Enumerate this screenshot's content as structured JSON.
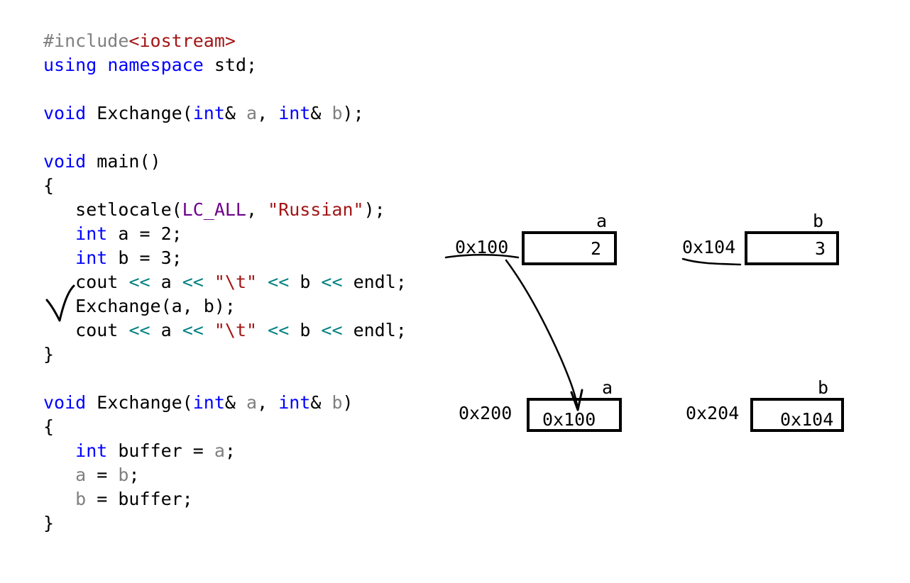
{
  "code": {
    "include_directive": "#include",
    "include_file": "<iostream>",
    "using_kw": "using",
    "namespace_kw": "namespace",
    "std_rest": " std;",
    "void_kw": "void",
    "int_kw": "int",
    "int_ref": "int&",
    "exchange_name": " Exchange(",
    "decl_end": ");",
    "def_end": ")",
    "main_sig": " main()",
    "open_brace": "{",
    "close_brace": "}",
    "param_a": "a",
    "param_b": "b",
    "comma": ", ",
    "sp": " ",
    "setlocale": "setlocale(",
    "lc_all": "LC_ALL",
    "russian": "\"Russian\"",
    "int_a_rest": " a = 2;",
    "int_b_rest": " b = 3;",
    "cout": "cout",
    "shift": "<<",
    "a_mid": " a ",
    "b_mid": " b ",
    "tab_str": "\"\\t\"",
    "endl_rest": " endl;",
    "exchange_call": "Exchange(a, b);",
    "buffer_rest": " buffer = ",
    "semicolon": ";",
    "assign": " = ",
    "buffer_end": "buffer;"
  },
  "diagram": {
    "row1": {
      "a_name": "a",
      "a_address": "0x100",
      "a_value": "2",
      "b_name": "b",
      "b_address": "0x104",
      "b_value": "3"
    },
    "row2": {
      "a_name": "a",
      "a_address": "0x200",
      "a_value": "0x100",
      "b_name": "b",
      "b_address": "0x204",
      "b_value": "0x104"
    }
  }
}
